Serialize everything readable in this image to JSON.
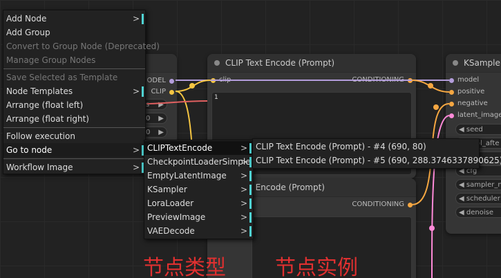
{
  "context_menu": {
    "items": [
      {
        "label": "Add Node",
        "submenu": true,
        "disabled": false
      },
      {
        "label": "Add Group",
        "submenu": false,
        "disabled": false
      },
      {
        "label": "Convert to Group Node (Deprecated)",
        "submenu": false,
        "disabled": true
      },
      {
        "label": "Manage Group Nodes",
        "submenu": false,
        "disabled": true
      },
      {
        "label": "Save Selected as Template",
        "submenu": false,
        "disabled": true
      },
      {
        "label": "Node Templates",
        "submenu": true,
        "disabled": false
      },
      {
        "label": "Arrange (float left)",
        "submenu": false,
        "disabled": false
      },
      {
        "label": "Arrange (float right)",
        "submenu": false,
        "disabled": false
      },
      {
        "label": "Follow execution",
        "submenu": false,
        "disabled": false
      },
      {
        "label": "Go to node",
        "submenu": true,
        "disabled": false
      },
      {
        "label": "Workflow Image",
        "submenu": true,
        "disabled": false
      }
    ]
  },
  "node_type_menu": {
    "items": [
      {
        "label": "CLIPTextEncode"
      },
      {
        "label": "CheckpointLoaderSimple"
      },
      {
        "label": "EmptyLatentImage"
      },
      {
        "label": "KSampler"
      },
      {
        "label": "LoraLoader"
      },
      {
        "label": "PreviewImage"
      },
      {
        "label": "VAEDecode"
      }
    ],
    "arrow": ">"
  },
  "node_instance_menu": {
    "items": [
      {
        "label": "CLIP Text Encode (Prompt) - #4 (690, 80)"
      },
      {
        "label": "CLIP Text Encode (Prompt) - #5 (690, 288.3746337890625)"
      }
    ]
  },
  "nodes": {
    "clip_text_encode_1": {
      "title": "CLIP Text Encode (Prompt)",
      "input": "clip",
      "output": "CONDITIONING",
      "text_value": "1"
    },
    "clip_text_encode_2": {
      "title_partial": "xt Encode (Prompt)",
      "output": "CONDITIONING"
    },
    "ksampler": {
      "title": "KSampler",
      "inputs": [
        "model",
        "positive",
        "negative",
        "latent_image"
      ],
      "widgets": [
        "seed",
        "ntrol_afte",
        "s",
        "cfg",
        "sampler_na",
        "scheduler",
        "denoise"
      ]
    },
    "left_node": {
      "outputs": [
        "ODEL",
        "CLIP"
      ],
      "widget_fragments": [
        "s",
        "0",
        "0"
      ]
    }
  },
  "annotations": {
    "node_type": "节点类型",
    "node_instance": "节点实例"
  },
  "colors": {
    "accent_bar": "#4fd3d3",
    "annotation": "#e03030",
    "clip_wire": "#f5c542",
    "model_wire": "#b39ddb",
    "cond_wire": "#f5a742",
    "latent_wire": "#ff8ad8",
    "neg_wire": "#e06060"
  }
}
